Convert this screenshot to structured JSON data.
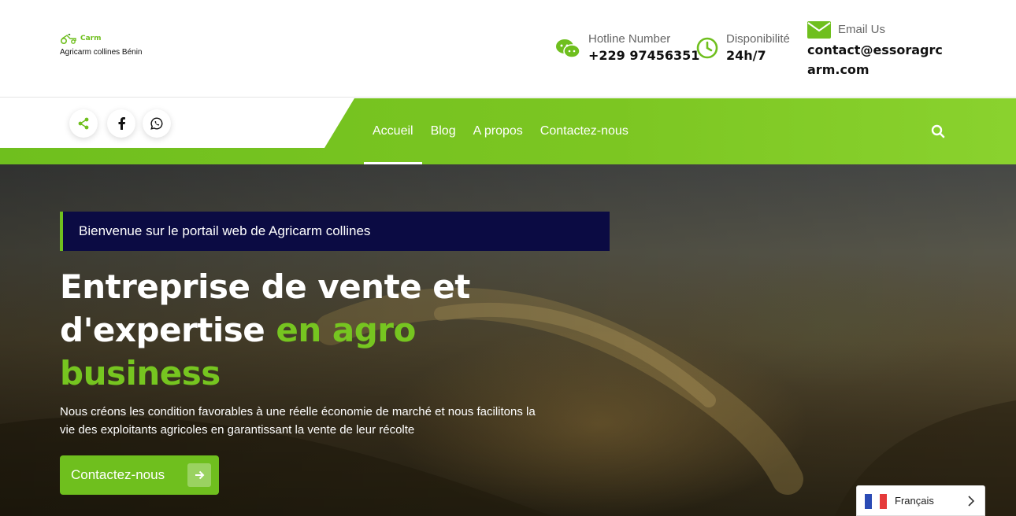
{
  "logo": {
    "brand": "Carm",
    "tagline": "Agricarm collines Bénin"
  },
  "contact": {
    "hotline_label": "Hotline Number",
    "hotline_value": "+229 97456351",
    "availability_label": "Disponibilité",
    "availability_value": "24h/7",
    "email_label": "Email Us",
    "email_line1": "contact@essoragrc",
    "email_line2": "arm.com"
  },
  "social": [
    "share-icon",
    "facebook-icon",
    "whatsapp-icon"
  ],
  "nav": {
    "items": [
      "Accueil",
      "Blog",
      "A propos",
      "Contactez-nous"
    ],
    "active": "Accueil"
  },
  "hero": {
    "welcome": "Bienvenue sur le portail web de Agricarm collines",
    "title_line1": "Entreprise de vente et",
    "title_line2a": "d'expertise ",
    "title_line2b": "en agro",
    "title_line3": "business",
    "lead": "Nous créons les condition favorables à une réelle économie de marché et nous facilitons la vie des exploitants agricoles en garantissant la vente de leur récolte",
    "cta": "Contactez-nous"
  },
  "language": {
    "selected": "Français"
  },
  "colors": {
    "accent": "#6fbf1e",
    "banner": "#0b0b43",
    "text_dark": "#111111"
  }
}
